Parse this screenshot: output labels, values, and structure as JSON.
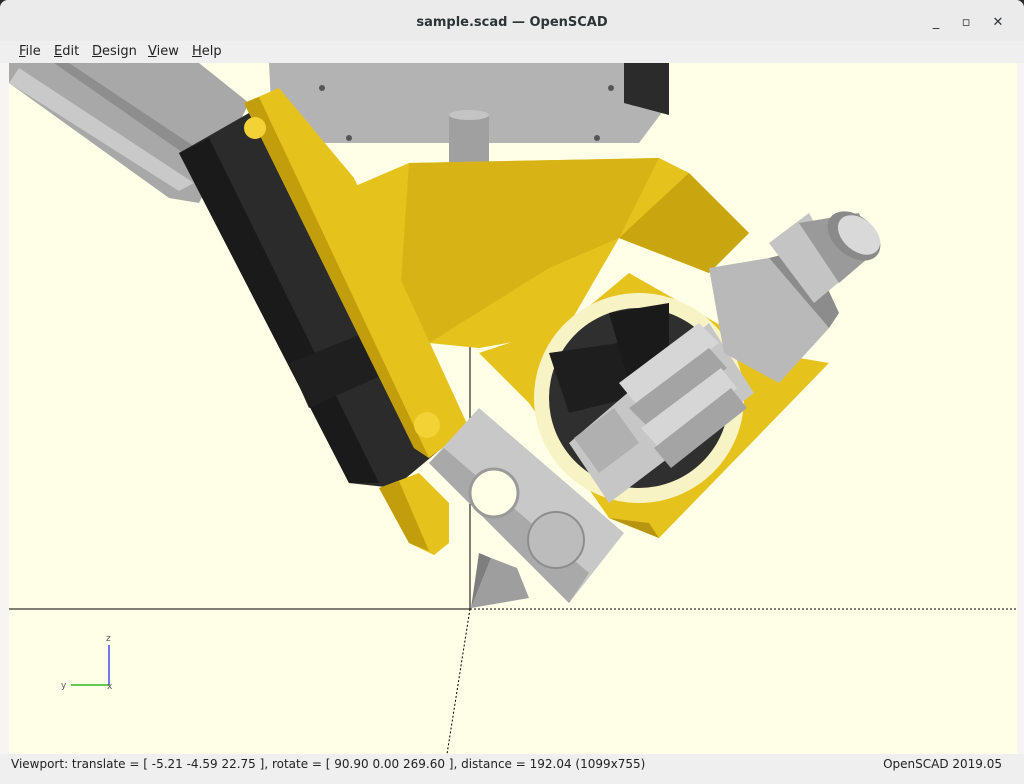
{
  "window": {
    "title": "sample.scad — OpenSCAD",
    "minimize_glyph": "_",
    "maximize_glyph": "▫",
    "close_glyph": "✕"
  },
  "menubar": {
    "items": [
      {
        "mnemonic": "F",
        "rest": "ile"
      },
      {
        "mnemonic": "E",
        "rest": "dit"
      },
      {
        "mnemonic": "D",
        "rest": "esign"
      },
      {
        "mnemonic": "V",
        "rest": "iew"
      },
      {
        "mnemonic": "H",
        "rest": "elp"
      }
    ]
  },
  "axes_indicator": {
    "z": "z",
    "y": "y",
    "x": "x"
  },
  "statusbar": {
    "viewport_info": "Viewport: translate = [ -5.21 -4.59 22.75 ], rotate = [ 90.90 0.00 269.60 ], distance = 192.04 (1099x755)",
    "version": "OpenSCAD 2019.05"
  },
  "colors": {
    "background": "#fffee6",
    "part_yellow": "#e6c21c",
    "part_gray": "#bdbdbd",
    "part_black": "#2b2b2b"
  }
}
